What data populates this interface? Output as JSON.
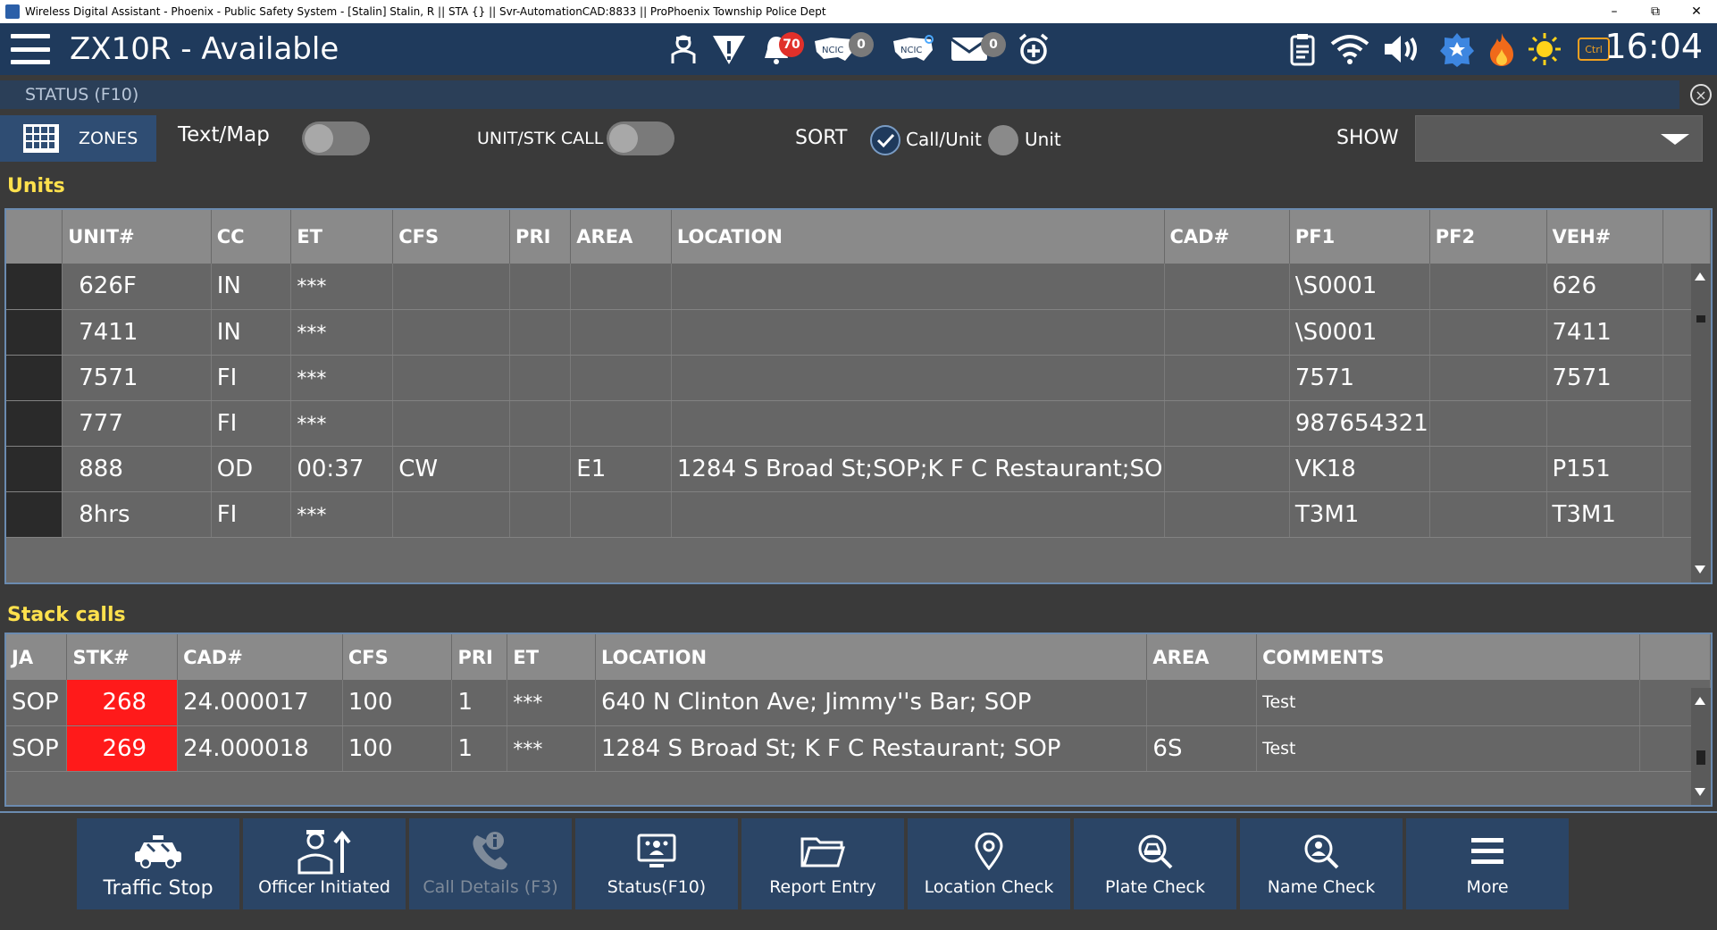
{
  "window": {
    "title": "Wireless Digital Assistant - Phoenix - Public Safety System - [Stalin] Stalin, R || STA {} || Svr-AutomationCAD:8833 || ProPhoenix Township Police Dept",
    "minimize": "–",
    "restore": "⧉",
    "close": "✕"
  },
  "header": {
    "unit_title": "ZX10R - Available",
    "notification_count": "70",
    "ncic_count_1": "0",
    "ncic_count_2": "0",
    "mail_count": "0",
    "ncic_label": "NCIC",
    "ctrl_label": "Ctrl",
    "clock": "16:04",
    "colors": {
      "bar": "#1f3a5c",
      "badge_red": "#e0302a",
      "badge_gray": "#7a7a7a"
    }
  },
  "status_tab": {
    "label": "STATUS (F10)",
    "close": "×"
  },
  "toolbar": {
    "zones_label": "ZONES",
    "text_map_label": "Text/Map",
    "unit_stk_call_label": "UNIT/STK CALL",
    "sort_label": "SORT",
    "sort_options": [
      {
        "label": "Call/Unit",
        "selected": true
      },
      {
        "label": "Unit",
        "selected": false
      }
    ],
    "show_label": "SHOW",
    "show_value": ""
  },
  "units": {
    "title": "Units",
    "columns": [
      "",
      "UNIT#",
      "CC",
      "ET",
      "CFS",
      "PRI",
      "AREA",
      "LOCATION",
      "CAD#",
      "PF1",
      "PF2",
      "VEH#",
      ""
    ],
    "rows": [
      [
        "626F",
        "IN",
        "***",
        "",
        "",
        "",
        "",
        "",
        "\\S0001",
        "",
        "626"
      ],
      [
        "7411",
        "IN",
        "***",
        "",
        "",
        "",
        "",
        "",
        "\\S0001",
        "",
        "7411"
      ],
      [
        "7571",
        "FI",
        "***",
        "",
        "",
        "",
        "",
        "",
        "7571",
        "",
        "7571"
      ],
      [
        "777",
        "FI",
        "***",
        "",
        "",
        "",
        "",
        "",
        "987654321",
        "",
        ""
      ],
      [
        "888",
        "OD",
        "00:37",
        "CW",
        "",
        "E1",
        "1284 S Broad St;SOP;K F C Restaurant;SO",
        "",
        "VK18",
        "",
        "P151"
      ],
      [
        "8hrs",
        "FI",
        "***",
        "",
        "",
        "",
        "",
        "",
        "T3M1",
        "",
        "T3M1"
      ]
    ]
  },
  "stack_calls": {
    "title": "Stack calls",
    "columns": [
      "JA",
      "STK#",
      "CAD#",
      "CFS",
      "PRI",
      "ET",
      "LOCATION",
      "AREA",
      "COMMENTS",
      ""
    ],
    "rows": [
      [
        "SOP",
        "268",
        "24.000017",
        "100",
        "1",
        "***",
        "640 N Clinton Ave; Jimmy''s Bar; SOP",
        "",
        "Test"
      ],
      [
        "SOP",
        "269",
        "24.000018",
        "100",
        "1",
        "***",
        "1284 S Broad St; K F C Restaurant; SOP",
        "6S",
        "Test"
      ]
    ],
    "colors": {
      "stk_highlight": "#ff1a1a"
    }
  },
  "bottom_bar": {
    "buttons": [
      {
        "label": "Traffic Stop",
        "icon": "police-car-icon",
        "enabled": true
      },
      {
        "label": "Officer Initiated",
        "icon": "officer-arrow-icon",
        "enabled": true
      },
      {
        "label": "Call Details (F3)",
        "icon": "phone-info-icon",
        "enabled": false
      },
      {
        "label": "Status(F10)",
        "icon": "status-monitor-icon",
        "enabled": true
      },
      {
        "label": "Report Entry",
        "icon": "folder-icon",
        "enabled": true
      },
      {
        "label": "Location Check",
        "icon": "map-pin-icon",
        "enabled": true
      },
      {
        "label": "Plate Check",
        "icon": "plate-search-icon",
        "enabled": true
      },
      {
        "label": "Name Check",
        "icon": "person-search-icon",
        "enabled": true
      },
      {
        "label": "More",
        "icon": "menu-icon",
        "enabled": true
      }
    ]
  }
}
